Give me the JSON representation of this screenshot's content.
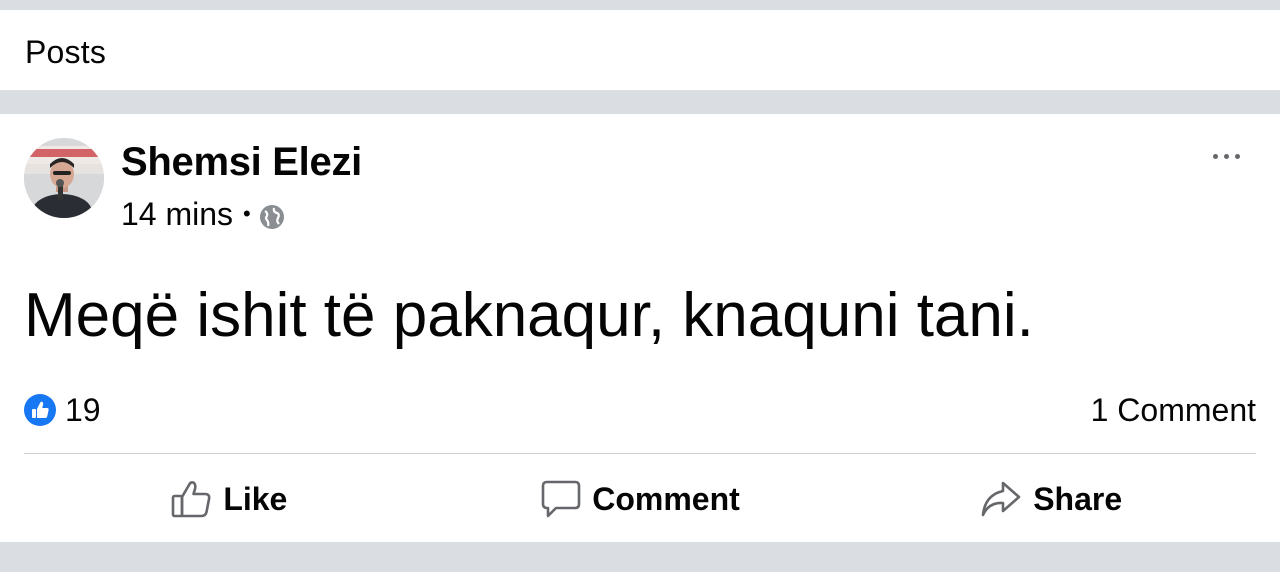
{
  "header": {
    "title": "Posts"
  },
  "post": {
    "author": "Shemsi Elezi",
    "time": "14 mins",
    "separator": "•",
    "audience_icon": "globe-icon",
    "text": "Meqë ishit të paknaqur, knaquni tani.",
    "reactions": {
      "icon": "like-badge-icon",
      "count": "19"
    },
    "comments_label": "1 Comment",
    "actions": {
      "like": "Like",
      "comment": "Comment",
      "share": "Share"
    }
  },
  "colors": {
    "background": "#dadde1",
    "card": "#ffffff",
    "text": "#050505",
    "secondary": "#65676b",
    "like_blue": "#1877f2",
    "divider": "#ced0d4"
  }
}
